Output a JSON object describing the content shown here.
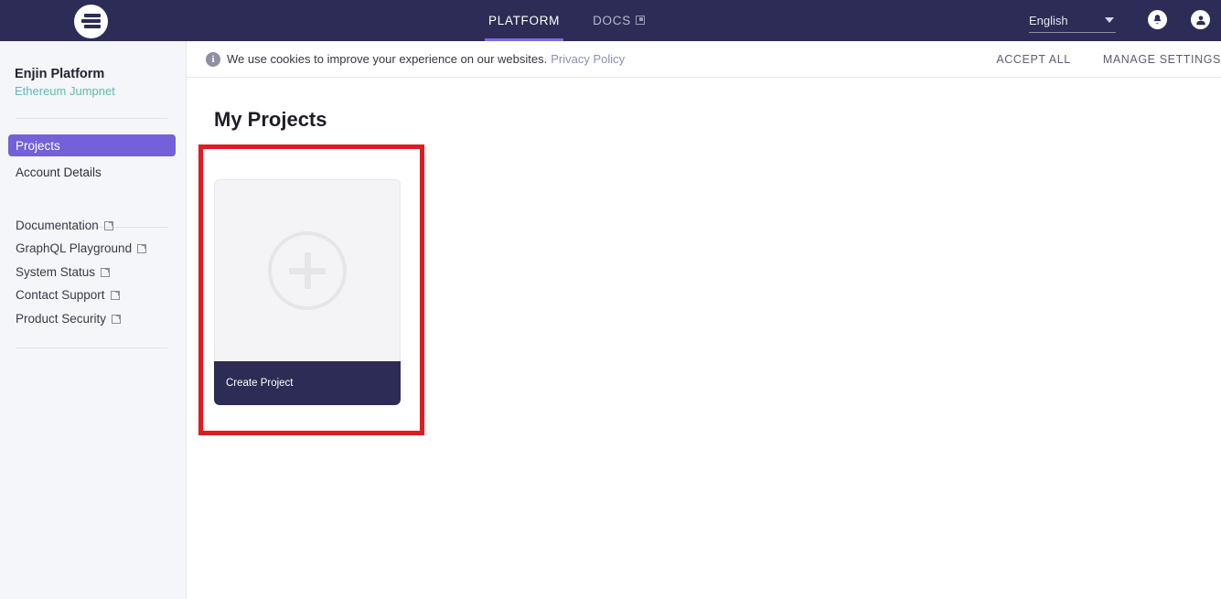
{
  "header": {
    "logo_name": "enjin-logo",
    "nav": [
      {
        "label": "PLATFORM",
        "active": true,
        "external": false
      },
      {
        "label": "DOCS",
        "active": false,
        "external": true
      }
    ],
    "language": {
      "value": "English"
    },
    "icons": [
      {
        "name": "notification-bell-icon"
      },
      {
        "name": "account-avatar-icon"
      }
    ]
  },
  "cookie_banner": {
    "info_glyph": "i",
    "message": "We use cookies to improve your experience on our websites.",
    "policy_link": "Privacy Policy",
    "accept_label": "ACCEPT ALL",
    "manage_label": "MANAGE SETTINGS"
  },
  "sidebar": {
    "title": "Enjin Platform",
    "subtitle": "Ethereum Jumpnet",
    "nav_items": [
      {
        "label": "Projects",
        "active": true
      },
      {
        "label": "Account Details",
        "active": false
      }
    ],
    "external_links": [
      {
        "label": "Documentation"
      },
      {
        "label": "GraphQL Playground"
      },
      {
        "label": "System Status"
      },
      {
        "label": "Contact Support"
      },
      {
        "label": "Product Security"
      }
    ]
  },
  "main": {
    "page_title": "My Projects",
    "create_card": {
      "footer_label": "Create Project",
      "icon": "plus-circle-icon"
    }
  },
  "annotation": {
    "highlight_color": "#e01b22"
  },
  "colors": {
    "header_bg": "#2c2c56",
    "accent_purple": "#7460d8",
    "nav_underline": "#7c6ce0",
    "sidebar_bg": "#f4f6fa",
    "subtitle_teal": "#5fb9b0",
    "card_footer": "#2c2c56"
  }
}
